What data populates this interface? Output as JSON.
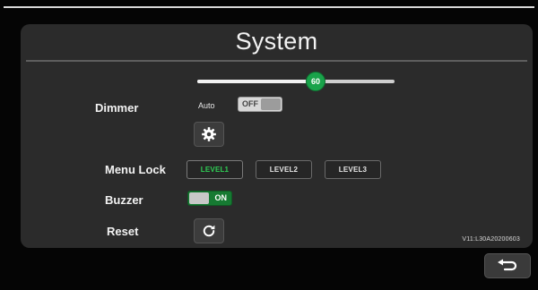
{
  "screen": {
    "title": "System",
    "version": "V11:L30A20200603"
  },
  "dimmer": {
    "label": "Dimmer",
    "level": 60,
    "level_text": "60",
    "level_max": 100,
    "auto_label": "Auto",
    "auto_toggle": {
      "state_text": "OFF",
      "on": false
    },
    "settings_icon": "gear-icon"
  },
  "menu_lock": {
    "label": "Menu Lock",
    "levels": [
      "LEVEL1",
      "LEVEL2",
      "LEVEL3"
    ],
    "selected": "LEVEL1"
  },
  "buzzer": {
    "label": "Buzzer",
    "toggle": {
      "state_text": "ON",
      "on": true
    }
  },
  "reset": {
    "label": "Reset",
    "icon": "refresh-icon"
  },
  "back": {
    "icon": "back-arrow-icon"
  },
  "colors": {
    "accent_green": "#19a34a",
    "active_text_green": "#2fcf55",
    "panel": "#2b2b2b",
    "background": "#000000"
  }
}
